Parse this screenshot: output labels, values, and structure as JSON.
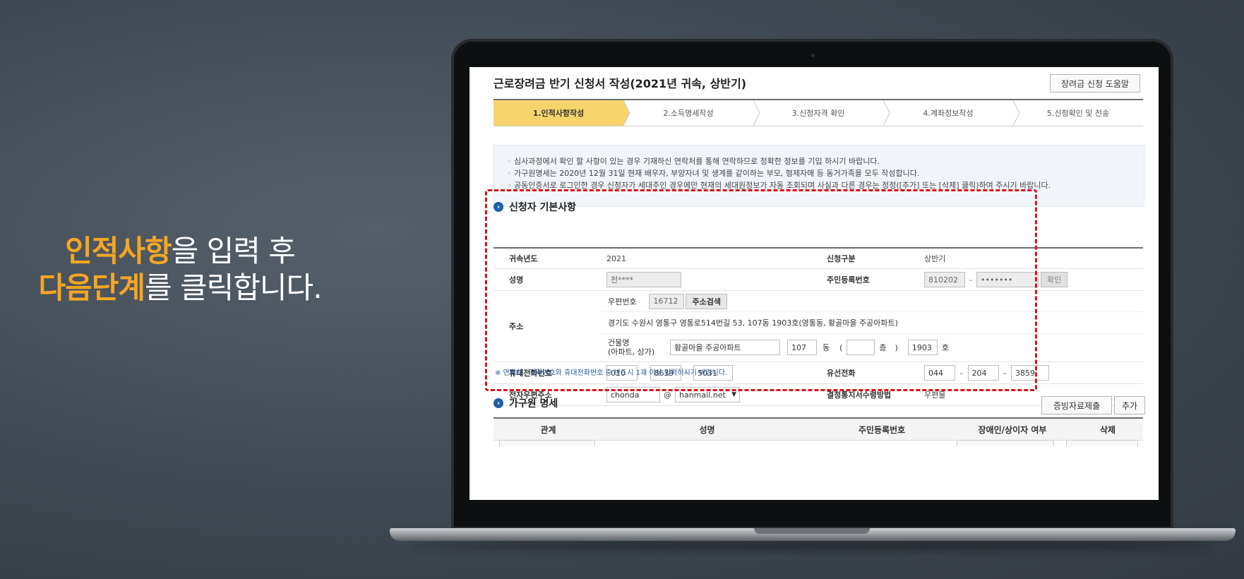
{
  "caption": {
    "line1_highlight": "인적사항",
    "line1_rest": "을 입력 후",
    "line2_highlight": "다음단계",
    "line2_rest": "를 클릭합니다."
  },
  "page": {
    "title": "근로장려금 반기 신청서 작성(2021년 귀속, 상반기)",
    "help_button": "장려금 신청 도움말"
  },
  "steps": [
    {
      "label": "1.인적사항작성",
      "active": true
    },
    {
      "label": "2.소득명세작성",
      "active": false
    },
    {
      "label": "3.신청자격 확인",
      "active": false
    },
    {
      "label": "4.계좌정보작성",
      "active": false
    },
    {
      "label": "5.신청확인 및 전송",
      "active": false
    }
  ],
  "notices": [
    "심사과정에서 확인 할 사항이 있는 경우 기재하신 연락처를 통해 연락하므로 정확한 정보를 기입 하시기 바랍니다.",
    "가구원명세는 2020년 12월 31일 현재 배우자, 부양자녀 및 생계를 같이하는 부모, 형제자매 등 동거가족을 모두 작성합니다.",
    "공동인증서로 로그인한 경우 신청자가 세대주인 경우에만 현재의 세대원정보가 자동 조회되며 사실과 다른 경우는 정정([추가] 또는 [삭제] 클릭)하여 주시기 바랍니다."
  ],
  "basic": {
    "section_title": "신청자 기본사항",
    "year_label": "귀속년도",
    "year_value": "2021",
    "type_label": "신청구분",
    "type_value": "상반기",
    "name_label": "성명",
    "name_value": "전****",
    "rrn_label": "주민등록번호",
    "rrn_front": "810202",
    "rrn_dash": "-",
    "rrn_back": "•••••••",
    "rrn_confirm": "확인",
    "address_label": "주소",
    "postal_label": "우편번호",
    "postal_value": "16712",
    "postal_search": "주소검색",
    "address_value": "경기도 수원시 영통구 영통로514번길 53, 107동 1903호(영통동, 황골마을 주공아파트)",
    "building_label": "건물명",
    "building_sub": "(아파트, 상가)",
    "building_value": "황골마을 주공아파트",
    "dong_value": "107",
    "dong_unit": "동",
    "paren_open": "(",
    "floor_value": "",
    "floor_unit": "층",
    "paren_close": ")",
    "ho_value": "1903",
    "ho_unit": "호",
    "mobile_label": "휴대전화번호",
    "mobile_1": "010",
    "mobile_2": "8639",
    "mobile_3": "5031",
    "landline_label": "유선전화",
    "landline_1": "044",
    "landline_2": "204",
    "landline_3": "3859",
    "email_label": "전자우편주소",
    "email_user": "chonda",
    "email_at": "@",
    "email_domain": "hanmail.net",
    "notice_method_label": "결정통지서수령방법",
    "notice_method_value": "우편물",
    "contact_note": "※ 연락처 : 전화번호와 휴대전화번호 중 반드시 1개 이상 입력하시기 바랍니다."
  },
  "household": {
    "section_title": "가구원 명세",
    "proof_button": "증빙자료제출",
    "add_button": "추가",
    "columns": [
      "관계",
      "성명",
      "주민등록번호",
      "장애인/상이자 여부",
      "삭제"
    ]
  },
  "colors": {
    "accent": "#f5a623",
    "active_step": "#f6d36b",
    "highlight_box": "#d9141c",
    "section_icon": "#1f5fa8"
  }
}
